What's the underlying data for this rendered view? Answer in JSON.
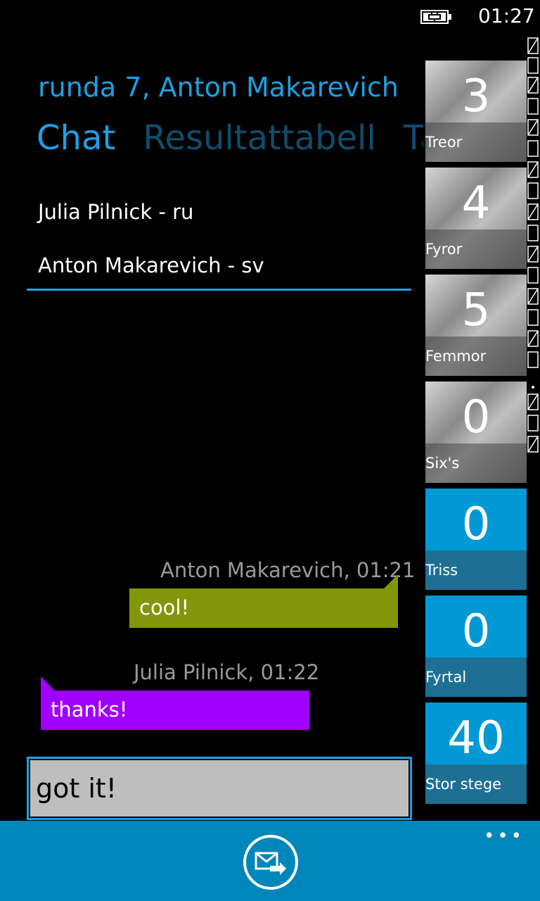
{
  "status": {
    "time": "01:27"
  },
  "header": {
    "title": "runda 7, Anton Makarevich"
  },
  "pivot": {
    "tabs": [
      "Chat",
      "Resultattabell",
      "Tärni"
    ]
  },
  "participants": [
    "Julia Pilnick  -  ru",
    "Anton Makarevich  -  sv"
  ],
  "messages": [
    {
      "meta": "Anton Makarevich, 01:21",
      "text": "cool!",
      "color": "#82960a"
    },
    {
      "meta": "Julia Pilnick, 01:22",
      "text": "thanks!",
      "color": "#a000ff"
    }
  ],
  "input": {
    "value": "got it!"
  },
  "score_tiles": [
    {
      "value": "3",
      "label": "Treor",
      "style": "gray"
    },
    {
      "value": "4",
      "label": "Fyror",
      "style": "gray"
    },
    {
      "value": "5",
      "label": "Femmor",
      "style": "gray"
    },
    {
      "value": "0",
      "label": "Six's",
      "style": "gray"
    },
    {
      "value": "0",
      "label": "Triss",
      "style": "blue"
    },
    {
      "value": "0",
      "label": "Fyrtal",
      "style": "blue"
    },
    {
      "value": "40",
      "label": "Stor stege",
      "style": "blue"
    }
  ],
  "app_bar": {
    "send_icon": "send-message-icon",
    "more": "•••"
  },
  "colors": {
    "accent": "#1ba1e2",
    "app_bar": "#0086bb",
    "outgoing": "#82960a",
    "incoming": "#a000ff"
  }
}
